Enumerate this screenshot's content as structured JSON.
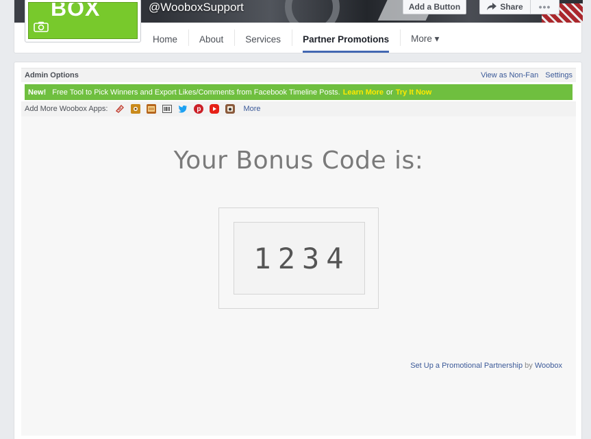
{
  "page": {
    "handle": "@WooboxSupport",
    "logo_text": "BOX",
    "add_button_label": "Add a Button",
    "share_label": "Share",
    "more_dots": "•••"
  },
  "tabs": [
    {
      "label": "Home"
    },
    {
      "label": "About"
    },
    {
      "label": "Services"
    },
    {
      "label": "Partner Promotions",
      "active": true
    },
    {
      "label": "More ▾"
    }
  ],
  "admin": {
    "title": "Admin Options",
    "view_as": "View as Non-Fan",
    "settings": "Settings"
  },
  "news": {
    "badge": "New!",
    "text": "Free Tool to Pick Winners and Export Likes/Comments from Facebook Timeline Posts.",
    "learn_more": "Learn More",
    "or": "or",
    "try_it": "Try It Now"
  },
  "apps": {
    "label": "Add More Woobox Apps:",
    "icons": [
      "coupon-icon",
      "photo-contest-icon",
      "coupon-code-icon",
      "barcode-icon",
      "twitter-icon",
      "pinterest-icon",
      "youtube-icon",
      "instagram-icon"
    ],
    "more": "More"
  },
  "bonus": {
    "title": "Your Bonus Code is:",
    "code": "1234"
  },
  "footer": {
    "link": "Set Up a Promotional Partnership",
    "by": "by",
    "brand": "Woobox"
  },
  "colors": {
    "fb_blue": "#4267b2",
    "news_green": "#6fbf3f",
    "news_link_yellow": "#ffe900",
    "profile_green": "#78c92c"
  }
}
